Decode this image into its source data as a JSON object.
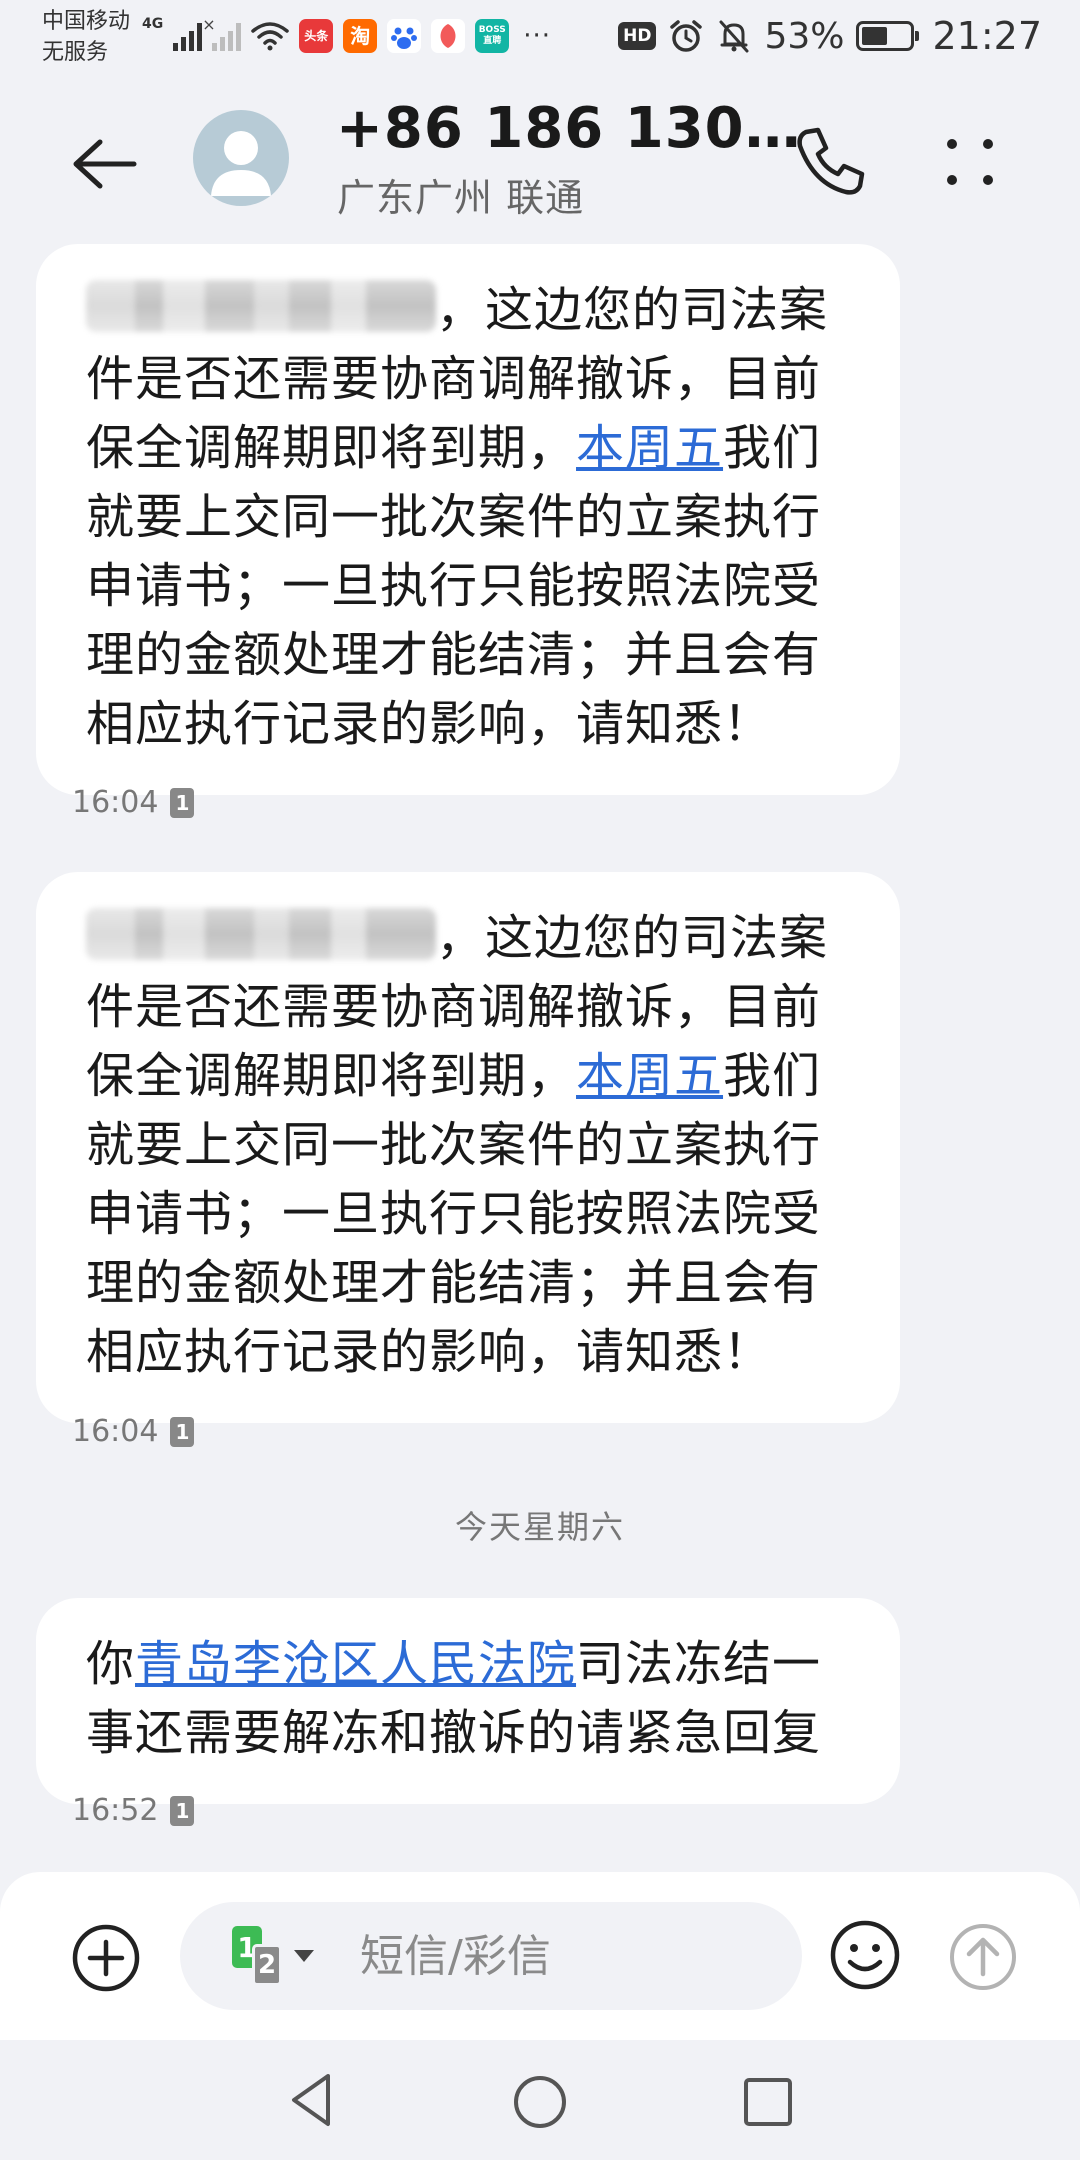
{
  "status_bar": {
    "carrier_line1": "中国移动",
    "carrier_line2": "无服务",
    "network_tag": "4G",
    "app_icons": [
      {
        "name": "toutiao",
        "label": "头条",
        "color": "#e8393a"
      },
      {
        "name": "taobao",
        "label": "淘",
        "color": "#ff6a00"
      },
      {
        "name": "baidu",
        "label": "",
        "color": "#2d6cf0"
      },
      {
        "name": "red-app",
        "label": "",
        "color": "#f25a5a"
      },
      {
        "name": "boss-zhipin",
        "label": "BOSS直聘",
        "color": "#12b5a4"
      }
    ],
    "more_icons": "···",
    "hd_badge": "HD",
    "battery_percent": "53%",
    "battery_level": 0.53,
    "time": "21:27"
  },
  "header": {
    "contact_number": "+86 186 130…",
    "contact_location": "广东广州 联通",
    "avatar_color": "#b7cbd6"
  },
  "messages": [
    {
      "text_before_link": "，这边您的司法案件是否还需要协商调解撤诉，目前保全调解期即将到期，",
      "link": "本周五",
      "text_after_link": "我们就要上交同一批次案件的立案执行申请书；一旦执行只能按照法院受理的金额处理才能结清；并且会有相应执行记录的影响，请知悉！",
      "time": "16:04",
      "sim": "1"
    },
    {
      "text_before_link": "，这边您的司法案件是否还需要协商调解撤诉，目前保全调解期即将到期，",
      "link": "本周五",
      "text_after_link": "我们就要上交同一批次案件的立案执行申请书；一旦执行只能按照法院受理的金额处理才能结清；并且会有相应执行记录的影响，请知悉！",
      "time": "16:04",
      "sim": "1"
    },
    {
      "text_before_link": "你",
      "link": "青岛李沧区人民法院",
      "text_after_link": "司法冻结一事还需要解冻和撤诉的请紧急回复",
      "time": "16:52",
      "sim": "1"
    }
  ],
  "day_divider": "今天星期六",
  "composer": {
    "sim_primary": "1",
    "sim_secondary": "2",
    "placeholder": "短信/彩信"
  },
  "colors": {
    "background": "#f1f2f6",
    "bubble": "#ffffff",
    "link": "#2c6bd6",
    "sim1_green": "#3dbb54"
  }
}
